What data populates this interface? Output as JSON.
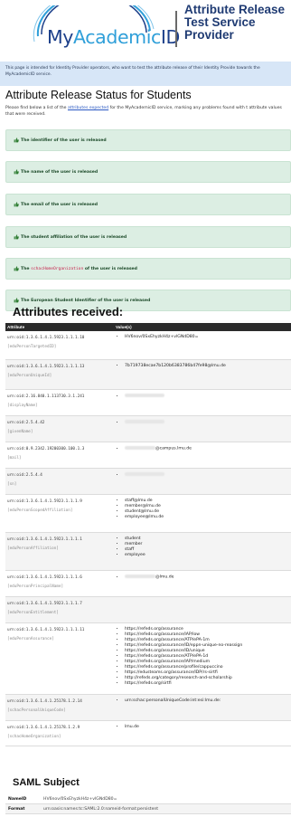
{
  "header": {
    "logo_prefix": "My",
    "logo_mid": "Academic",
    "logo_suffix": "ID",
    "title": "Attribute Release Test Service Provider",
    "brand_color": "#1c3f8a",
    "accent_color": "#2f9fd9"
  },
  "info": {
    "text": "This page is intended for Identity Provider operators, who want to test the attribute release of their Identity Provide towards the MyAcademicID service."
  },
  "status": {
    "heading": "Attribute Release Status for Students",
    "intro_before": "Please find below a list of the ",
    "intro_link": "attributes expected",
    "intro_after": " for the MyAcademicID service, marking any problems found with t attribute values that were received.",
    "icon": "thumbs-up-icon",
    "items": [
      {
        "text": "The identifier of the user is released"
      },
      {
        "text": "The name of the user is released"
      },
      {
        "text": "The email of the user is released"
      },
      {
        "text": "The student affiliation of the user is released"
      },
      {
        "pre": "The ",
        "code": "schacHomeOrganization",
        "post": " of the user is released"
      },
      {
        "text": "The European Student Identifier of the user is released"
      }
    ]
  },
  "attributes": {
    "heading": "Attributes received:",
    "col_attribute": "Attribute",
    "col_values": "Value(s)",
    "rows": [
      {
        "oid": "urn:oid:1.3.6.1.4.1.5923.1.1.1.10",
        "name": "[eduPersonTargetedID]",
        "values": [
          "HV6nov/0SxEhyzkH4z+vlGNdD80="
        ]
      },
      {
        "oid": "urn:oid:1.3.6.1.4.1.5923.1.1.1.13",
        "name": "[eduPersonUniqueId]",
        "values": [
          "7b719738ecae7b120b6383786b47fe98@lmu.de"
        ]
      },
      {
        "oid": "urn:oid:2.16.840.1.113730.3.1.241",
        "name": "[displayName]",
        "values": [
          ""
        ]
      },
      {
        "oid": "urn:oid:2.5.4.42",
        "name": "[givenName]",
        "values": [
          ""
        ]
      },
      {
        "oid": "urn:oid:0.9.2342.19200300.100.1.3",
        "name": "[mail]",
        "values": [
          "@campus.lmu.de"
        ]
      },
      {
        "oid": "urn:oid:2.5.4.4",
        "name": "[sn]",
        "values": [
          ""
        ]
      },
      {
        "oid": "urn:oid:1.3.6.1.4.1.5923.1.1.1.9",
        "name": "[eduPersonScopedAffiliation]",
        "values": [
          "staff@lmu.de",
          "member@lmu.de",
          "student@lmu.de",
          "employee@lmu.de"
        ]
      },
      {
        "oid": "urn:oid:1.3.6.1.4.1.5923.1.1.1.1",
        "name": "[eduPersonAffiliation]",
        "values": [
          "student",
          "member",
          "staff",
          "employee"
        ]
      },
      {
        "oid": "urn:oid:1.3.6.1.4.1.5923.1.1.1.6",
        "name": "[eduPersonPrincipalName]",
        "values": [
          "@lmu.de"
        ]
      },
      {
        "oid": "urn:oid:1.3.6.1.4.1.5923.1.1.1.7",
        "name": "[eduPersonEntitlement]",
        "values": []
      },
      {
        "oid": "urn:oid:1.3.6.1.4.1.5923.1.1.1.11",
        "name": "[eduPersonAssurance]",
        "values": [
          "https://refeds.org/assurance",
          "https://refeds.org/assurance/IAP/low",
          "https://refeds.org/assurance/ATP/ePA-1m",
          "https://refeds.org/assurance/ID/eppn-unique-no-reassign",
          "https://refeds.org/assurance/ID/unique",
          "https://refeds.org/assurance/ATP/ePA-1d",
          "https://refeds.org/assurance/IAP/medium",
          "https://refeds.org/assurance/profile/cappuccino",
          "https://edusteams.org/assurance/IDP/rs-sirtfi",
          "http://refeds.org/category/research-and-scholarship",
          "https://refeds.org/sirtfi"
        ]
      },
      {
        "oid": "urn:oid:1.3.6.1.4.1.25178.1.2.14",
        "name": "[schacPersonalUniqueCode]",
        "values": [
          "urn:schac:personalUniqueCode:int:esi:lmu.de:"
        ]
      },
      {
        "oid": "urn:oid:1.3.6.1.4.1.25178.1.2.9",
        "name": "[schacHomeOrganization]",
        "values": [
          "lmu.de"
        ]
      }
    ]
  },
  "saml": {
    "heading": "SAML Subject",
    "rows": [
      {
        "key": "NameID",
        "value": "HV6nov/0SxEhyzkH4z+vlGNdD80="
      },
      {
        "key": "Format",
        "value": "urn:oasis:names:tc:SAML:2.0:nameid-format:persistent"
      }
    ]
  }
}
